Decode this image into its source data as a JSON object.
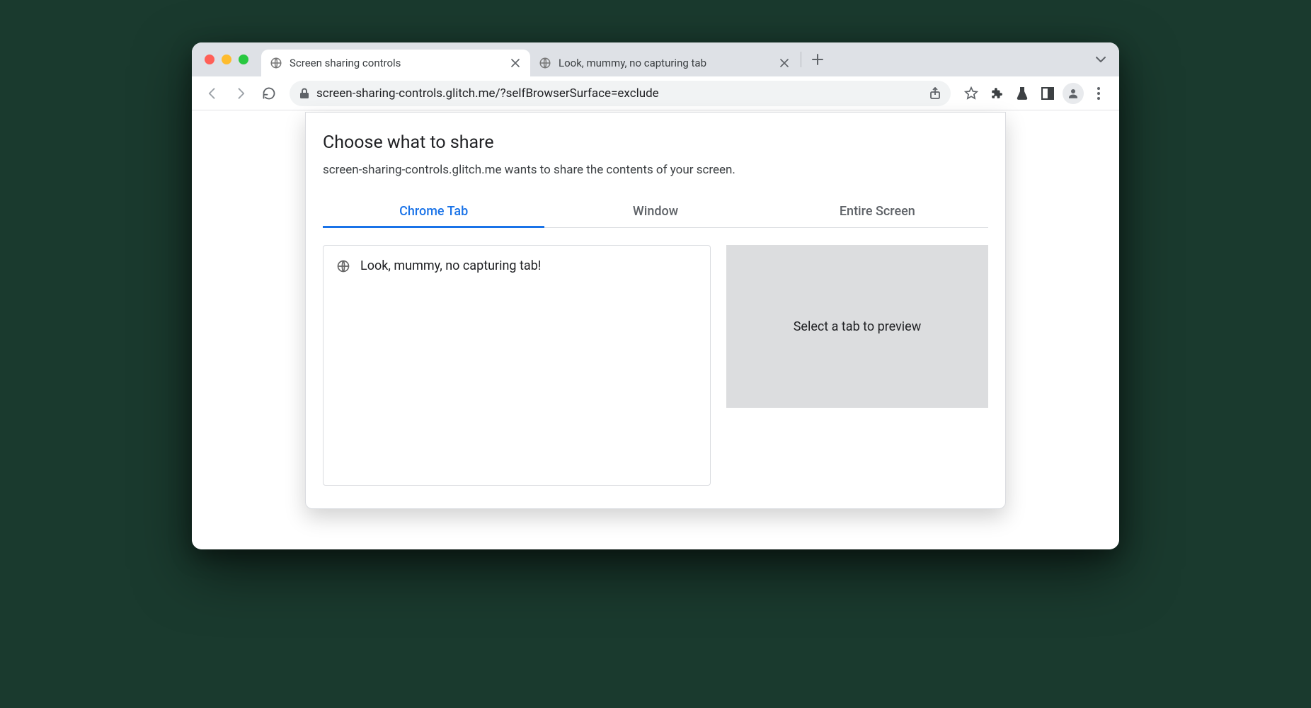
{
  "browser": {
    "tabs": [
      {
        "title": "Screen sharing controls",
        "active": true
      },
      {
        "title": "Look, mummy, no capturing tab",
        "active": false
      }
    ],
    "url": "screen-sharing-controls.glitch.me/?selfBrowserSurface=exclude"
  },
  "dialog": {
    "title": "Choose what to share",
    "subtitle": "screen-sharing-controls.glitch.me wants to share the contents of your screen.",
    "tabs": {
      "chrome_tab": "Chrome Tab",
      "window": "Window",
      "entire_screen": "Entire Screen"
    },
    "tab_list": [
      {
        "title": "Look, mummy, no capturing tab!"
      }
    ],
    "preview_placeholder": "Select a tab to preview"
  }
}
